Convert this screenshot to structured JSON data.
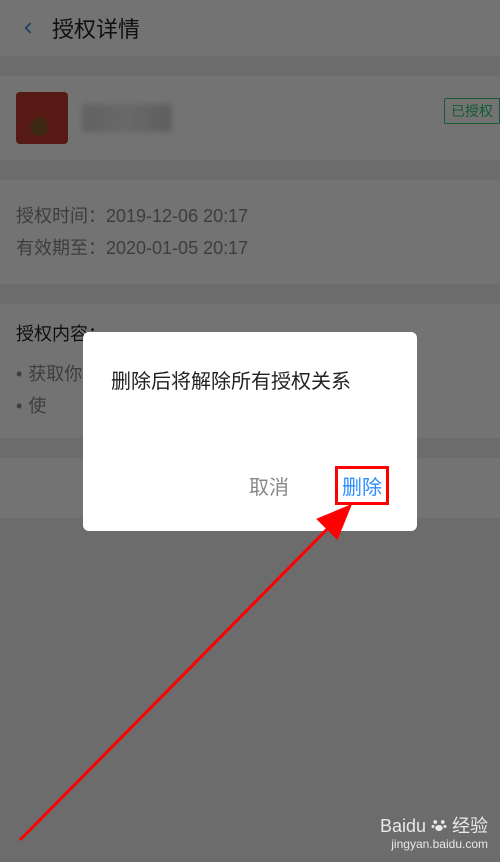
{
  "header": {
    "title": "授权详情"
  },
  "app": {
    "badge": "已授权"
  },
  "time": {
    "auth_label": "授权时间：",
    "auth_value": "2019-12-06 20:17",
    "valid_label": "有效期至：",
    "valid_value": "2020-01-05 20:17"
  },
  "content": {
    "title": "授权内容：",
    "items": [
      "获取你的公开信息(昵称、头像、性别等)",
      "使"
    ]
  },
  "dialog": {
    "message": "删除后将解除所有授权关系",
    "cancel": "取消",
    "delete": "删除"
  },
  "watermark": {
    "brand": "Baidu",
    "suffix": "经验",
    "url": "jingyan.baidu.com"
  }
}
